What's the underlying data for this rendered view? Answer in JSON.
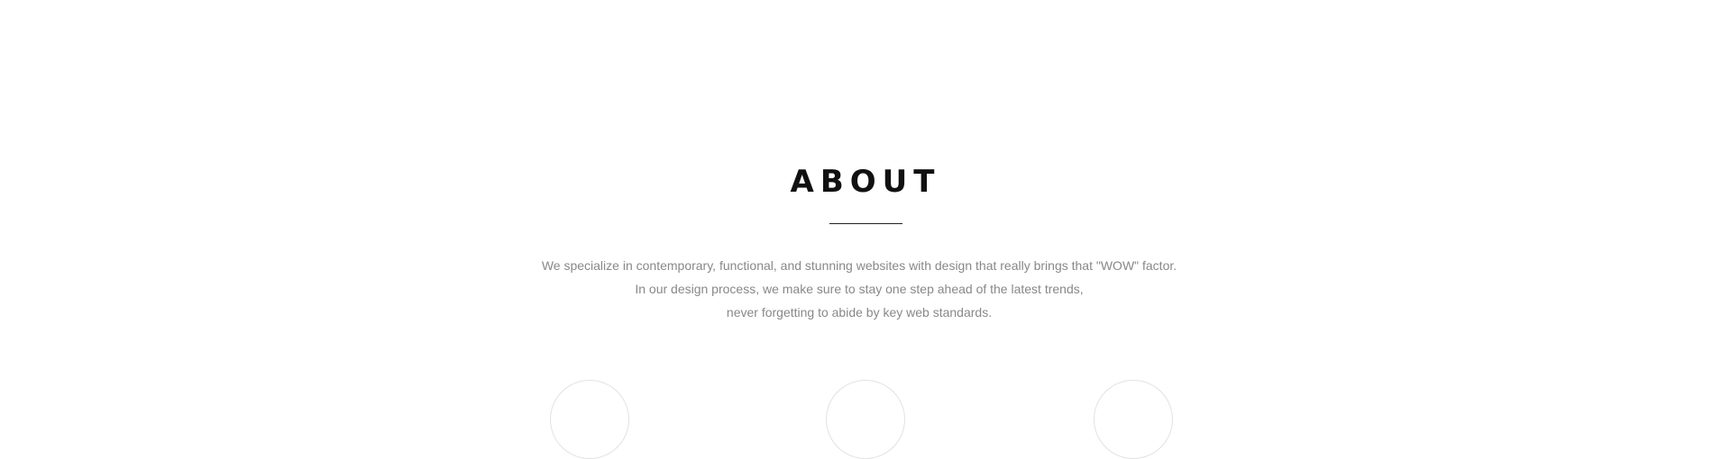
{
  "about": {
    "title": "ABOUT",
    "description": {
      "line1": "We specialize in contemporary, functional, and stunning websites with design that really brings that \"WOW\" factor.",
      "line2": "In our design process, we make sure to stay one step ahead of the latest trends,",
      "line3": "never forgetting to abide by key web standards."
    },
    "features": [
      {
        "icon": "feature-circle-icon"
      },
      {
        "icon": "feature-circle-icon"
      },
      {
        "icon": "feature-circle-icon"
      }
    ]
  },
  "colors": {
    "background": "#ffffff",
    "title": "#111111",
    "body_text": "#888888",
    "divider": "#222222",
    "circle_border": "#e2e2e2"
  }
}
